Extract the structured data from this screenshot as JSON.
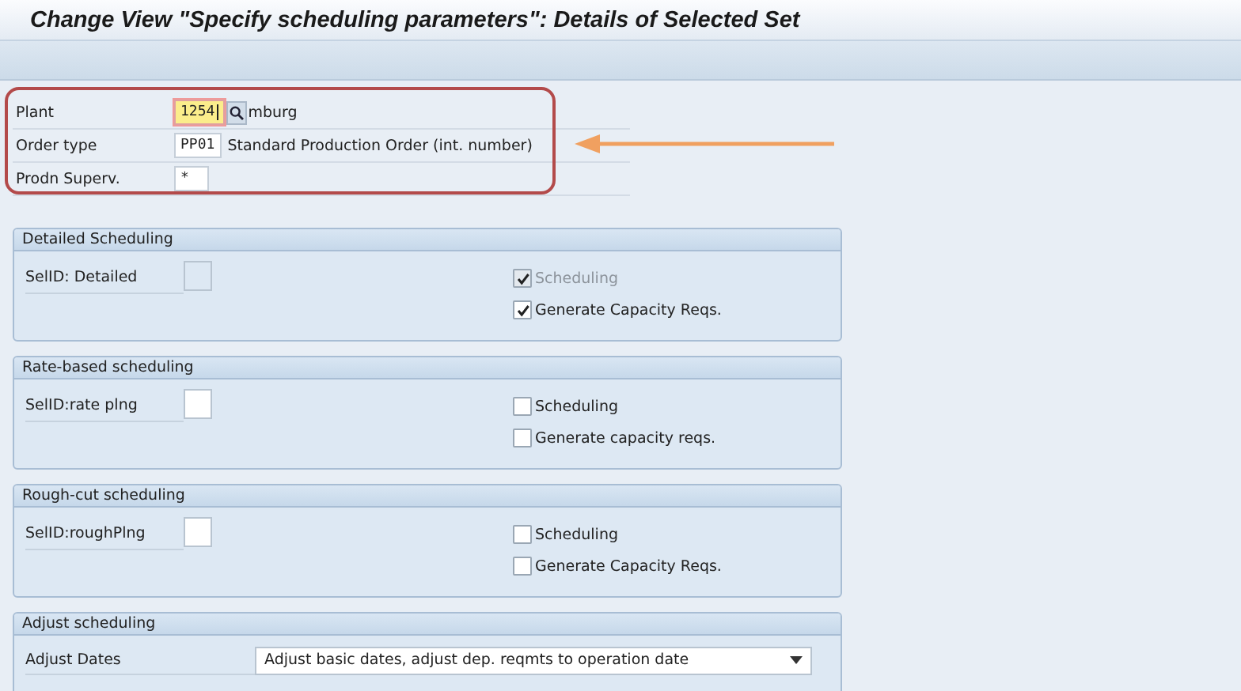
{
  "window": {
    "title": "Change View \"Specify scheduling parameters\": Details of Selected Set"
  },
  "header_fields": [
    {
      "label": "Plant",
      "value": "1254",
      "focused": true,
      "search_help": true,
      "description": "mburg"
    },
    {
      "label": "Order type",
      "value": "PP01",
      "focused": false,
      "search_help": false,
      "description": "Standard Production Order (int. number)"
    },
    {
      "label": "Prodn Superv.",
      "value": "*",
      "focused": false,
      "search_help": false
    }
  ],
  "groups": [
    {
      "title": "Detailed Scheduling",
      "kind": "checkboxes",
      "field": {
        "label": "SelID: Detailed",
        "disabled": true
      },
      "checkboxes": [
        {
          "label": "Scheduling",
          "checked": true,
          "disabled": true
        },
        {
          "label": "Generate Capacity Reqs.",
          "checked": true,
          "disabled": false
        }
      ]
    },
    {
      "title": "Rate-based scheduling",
      "kind": "checkboxes",
      "field": {
        "label": "SelID:rate plng",
        "disabled": false
      },
      "checkboxes": [
        {
          "label": "Scheduling",
          "checked": false,
          "disabled": false
        },
        {
          "label": "Generate capacity reqs.",
          "checked": false,
          "disabled": false
        }
      ]
    },
    {
      "title": "Rough-cut scheduling",
      "kind": "checkboxes",
      "field": {
        "label": "SelID:roughPlng",
        "disabled": false
      },
      "checkboxes": [
        {
          "label": "Scheduling",
          "checked": false,
          "disabled": false
        },
        {
          "label": "Generate Capacity Reqs.",
          "checked": false,
          "disabled": false
        }
      ]
    },
    {
      "title": "Adjust scheduling",
      "kind": "dropdown",
      "field": {
        "label": "Adjust Dates",
        "value": "Adjust basic dates, adjust dep. reqmts to operation date"
      }
    }
  ]
}
